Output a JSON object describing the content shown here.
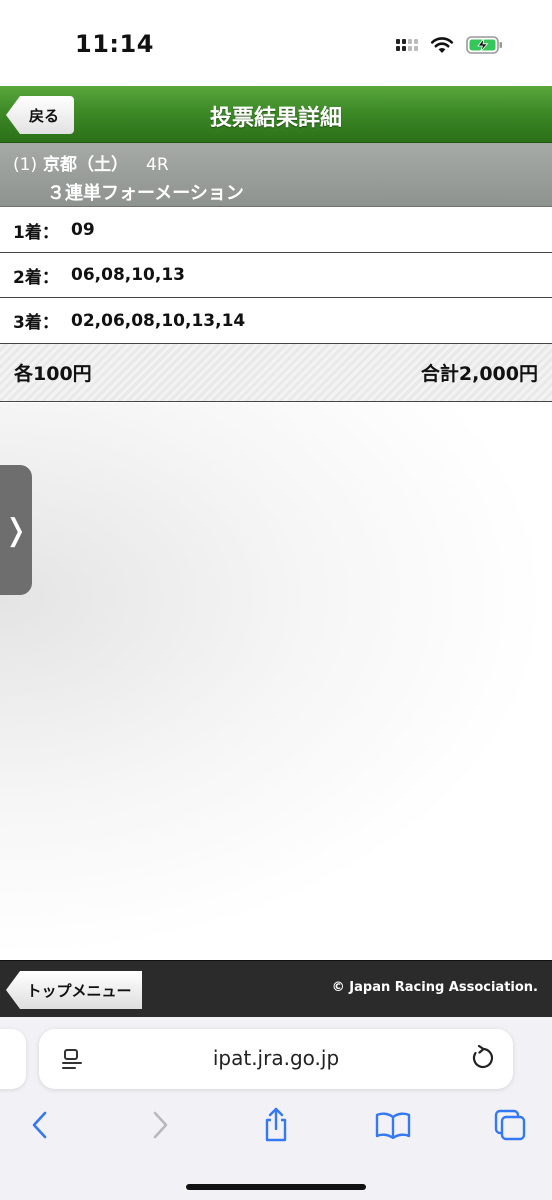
{
  "status_bar": {
    "time": "11:14"
  },
  "header": {
    "back_label": "戻る",
    "title": "投票結果詳細"
  },
  "race": {
    "number": "(1)",
    "venue_day": "京都（土）",
    "race_no": "4R",
    "bet_type": "３連単フォーメーション"
  },
  "placings": [
    {
      "label": "1着：",
      "horses": "09"
    },
    {
      "label": "2着：",
      "horses": "06,08,10,13"
    },
    {
      "label": "3着：",
      "horses": "02,06,08,10,13,14"
    }
  ],
  "totals": {
    "each": "各100円",
    "total": "合計2,000円"
  },
  "side_handle": {
    "glyph": "❭"
  },
  "footer": {
    "top_menu_label": "トップメニュー",
    "copyright": "© Japan Racing Association."
  },
  "browser": {
    "url": "ipat.jra.go.jp"
  },
  "colors": {
    "header_green": "#3d8a27",
    "race_band_gray": "#9a9e9b",
    "footer_dark": "#2b2b2b",
    "safari_blue": "#3478f6"
  }
}
